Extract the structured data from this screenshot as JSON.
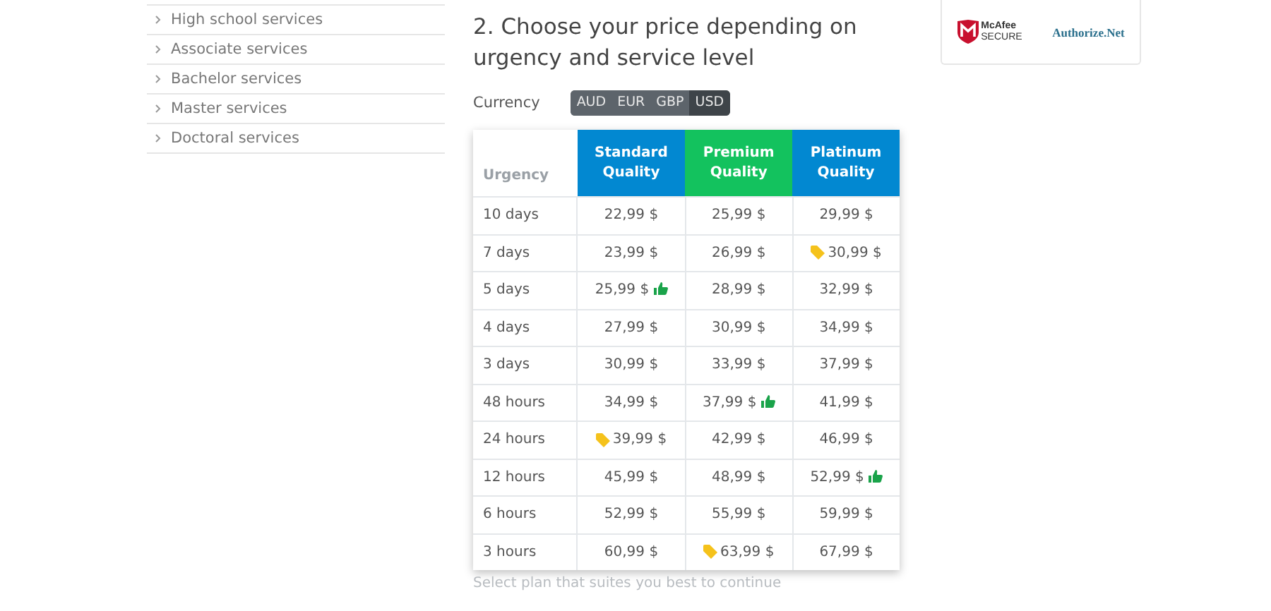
{
  "sidebar": {
    "items": [
      {
        "label": "High school services"
      },
      {
        "label": "Associate services"
      },
      {
        "label": "Bachelor services"
      },
      {
        "label": "Master services"
      },
      {
        "label": "Doctoral services"
      }
    ]
  },
  "heading": "2. Choose your price depending on urgency and service level",
  "badges": {
    "mcafee_line1": "McAfee",
    "mcafee_line2": "SECURE",
    "authorize": "Authorize.Net"
  },
  "currency": {
    "label": "Currency",
    "options": [
      {
        "label": "AUD",
        "selected": false
      },
      {
        "label": "EUR",
        "selected": false
      },
      {
        "label": "GBP",
        "selected": false
      },
      {
        "label": "USD",
        "selected": true
      }
    ]
  },
  "table": {
    "columns": [
      {
        "label": "Urgency"
      },
      {
        "label": "Standard Quality",
        "color": "#0288d1"
      },
      {
        "label": "Premium Quality",
        "color": "#13c25e"
      },
      {
        "label": "Platinum Quality",
        "color": "#0288d1"
      }
    ],
    "rows": [
      {
        "urgency": "10 days",
        "prices": [
          {
            "text": "22,99 $"
          },
          {
            "text": "25,99 $"
          },
          {
            "text": "29,99 $"
          }
        ]
      },
      {
        "urgency": "7 days",
        "prices": [
          {
            "text": "23,99 $"
          },
          {
            "text": "26,99 $"
          },
          {
            "text": "30,99 $",
            "discount": true
          }
        ]
      },
      {
        "urgency": "5 days",
        "prices": [
          {
            "text": "25,99 $",
            "recommended": true
          },
          {
            "text": "28,99 $"
          },
          {
            "text": "32,99 $"
          }
        ]
      },
      {
        "urgency": "4 days",
        "prices": [
          {
            "text": "27,99 $"
          },
          {
            "text": "30,99 $"
          },
          {
            "text": "34,99 $"
          }
        ]
      },
      {
        "urgency": "3 days",
        "prices": [
          {
            "text": "30,99 $"
          },
          {
            "text": "33,99 $"
          },
          {
            "text": "37,99 $"
          }
        ]
      },
      {
        "urgency": "48 hours",
        "prices": [
          {
            "text": "34,99 $"
          },
          {
            "text": "37,99 $",
            "recommended": true
          },
          {
            "text": "41,99 $"
          }
        ]
      },
      {
        "urgency": "24 hours",
        "prices": [
          {
            "text": "39,99 $",
            "discount": true
          },
          {
            "text": "42,99 $"
          },
          {
            "text": "46,99 $"
          }
        ]
      },
      {
        "urgency": "12 hours",
        "prices": [
          {
            "text": "45,99 $"
          },
          {
            "text": "48,99 $"
          },
          {
            "text": "52,99 $",
            "recommended": true
          }
        ]
      },
      {
        "urgency": "6 hours",
        "prices": [
          {
            "text": "52,99 $"
          },
          {
            "text": "55,99 $"
          },
          {
            "text": "59,99 $"
          }
        ]
      },
      {
        "urgency": "3 hours",
        "prices": [
          {
            "text": "60,99 $"
          },
          {
            "text": "63,99 $",
            "discount": true
          },
          {
            "text": "67,99 $"
          }
        ]
      }
    ]
  },
  "hint": "Select plan that suites you best to continue"
}
